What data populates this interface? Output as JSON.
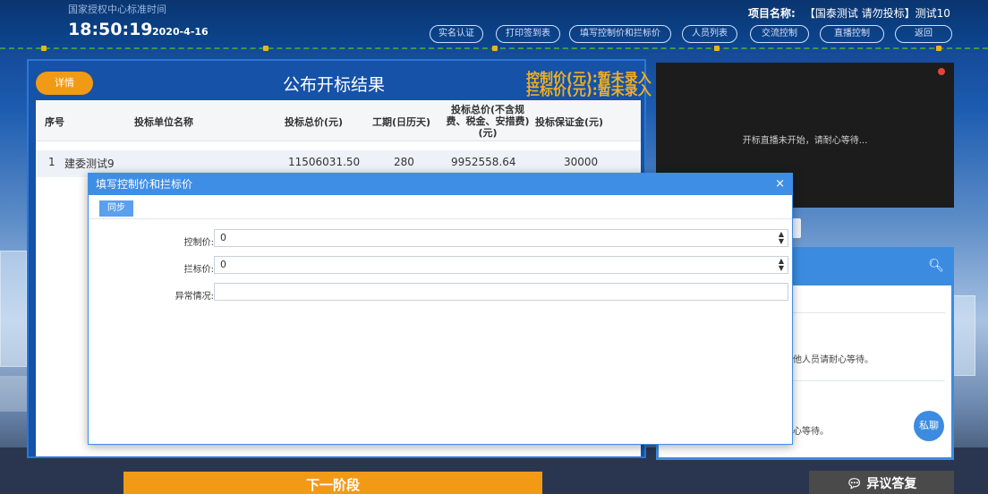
{
  "header": {
    "clock_label": "国家授权中心标准时间",
    "time": "18:50:19",
    "date": "2020-4-16",
    "project_label": "项目名称:",
    "project_name": "【国泰测试 请勿投标】测试10",
    "nav": [
      "实名认证",
      "打印签到表",
      "填写控制价和拦标价",
      "人员列表",
      "交流控制",
      "直播控制",
      "返回"
    ]
  },
  "left_panel": {
    "detail_button": "详情",
    "title": "公布开标结果",
    "control_price_line": "控制价(元):暂未录入",
    "block_price_line": "拦标价(元):暂未录入",
    "table": {
      "headers": [
        "序号",
        "投标单位名称",
        "投标总价(元)",
        "工期(日历天)",
        "投标总价(不含规费、税金、安措费)(元)",
        "投标保证金(元)"
      ],
      "rows": [
        [
          "1",
          "建委测试9",
          "11506031.50",
          "280",
          "9952558.64",
          "30000"
        ]
      ]
    }
  },
  "video": {
    "message": "开标直播未开始，请耐心等待..."
  },
  "chat": {
    "msg1": "他人员请耐心等待。",
    "msg2": "心等待。",
    "private_chat": "私聊"
  },
  "bottom": {
    "next_stage": "下一阶段",
    "objection_reply": "异议答复"
  },
  "modal": {
    "title": "填写控制价和拦标价",
    "close": "×",
    "sync_button": "同步",
    "fields": {
      "control_price_label": "控制价:",
      "control_price_value": "0",
      "block_price_label": "拦标价:",
      "block_price_value": "0",
      "anomaly_label": "异常情况:",
      "anomaly_value": ""
    }
  },
  "colors": {
    "accent_orange": "#f29a16",
    "header_blue": "#0c4690",
    "modal_blue": "#3f8ee6",
    "price_yellow": "#f2b01e"
  }
}
